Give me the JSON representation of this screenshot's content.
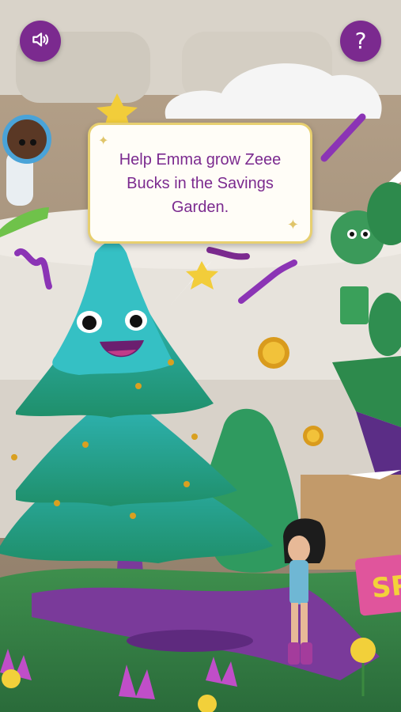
{
  "instruction": {
    "text": "Help Emma grow Zeee Bucks in the Savings Garden."
  },
  "controls": {
    "sound_icon": "speaker-icon",
    "help_label": "?"
  },
  "sign": {
    "text": "SP"
  },
  "colors": {
    "accent_purple": "#7b2a8f",
    "bubble_border": "#e7cf6f",
    "text_purple": "#7b2a8f",
    "sign_pink": "#e0559c",
    "sign_text": "#f3d23a"
  }
}
